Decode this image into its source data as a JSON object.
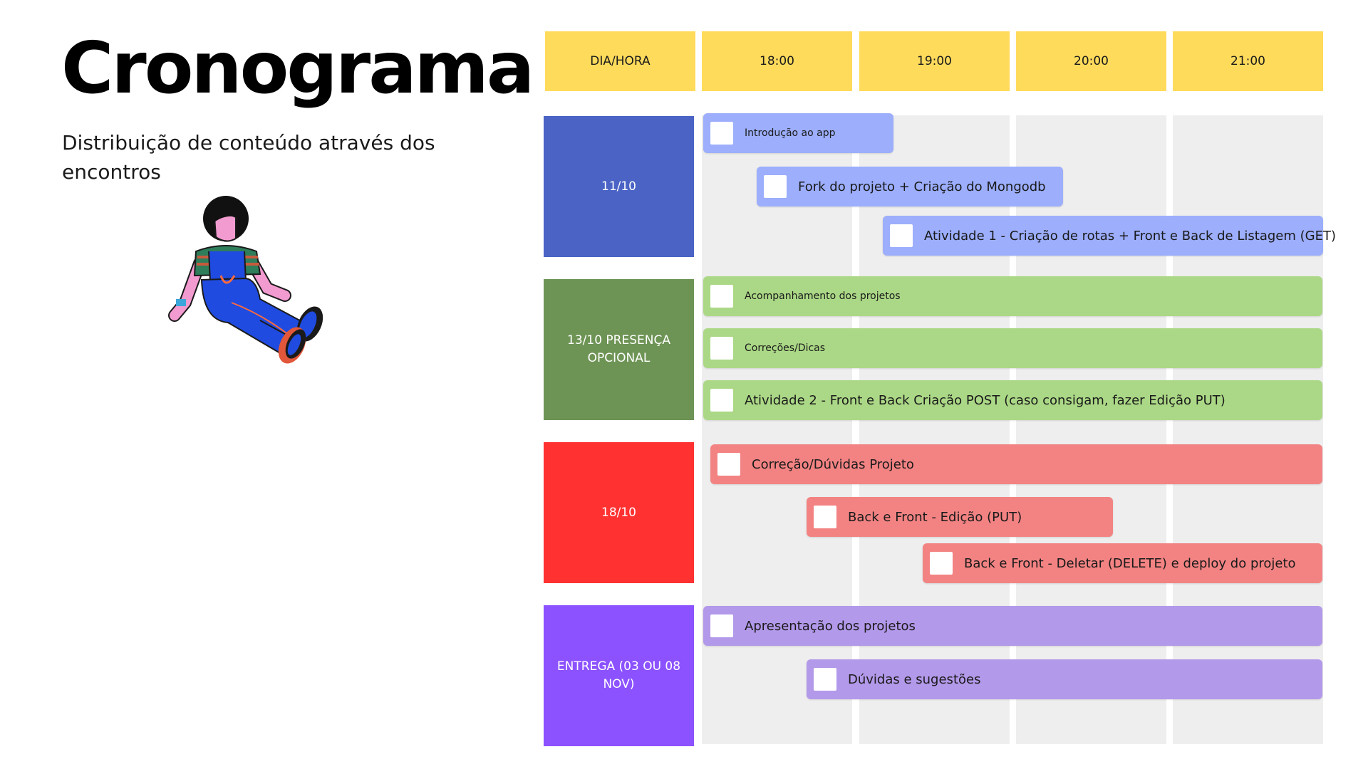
{
  "page": {
    "title": "Cronograma",
    "subtitle": "Distribuição de conteúdo através dos encontros"
  },
  "colors": {
    "header": "#FFDB5C",
    "column_bg": "#EEEEEE",
    "day1": "#4A63C5",
    "day1_bar": "#9CAEFC",
    "day2": "#6E9455",
    "day2_bar": "#ABD886",
    "day3": "#FF3131",
    "day3_bar": "#F38383",
    "day4": "#8C52FF",
    "day4_bar": "#B399EA"
  },
  "header": {
    "corner": "DIA/HORA",
    "times": [
      "18:00",
      "19:00",
      "20:00",
      "21:00"
    ]
  },
  "days": [
    {
      "label": "11/10",
      "tasks": [
        {
          "text": "Introdução ao app"
        },
        {
          "text": "Fork do projeto + Criação do Mongodb"
        },
        {
          "text": "Atividade 1 - Criação de rotas + Front e Back de Listagem (GET)"
        }
      ]
    },
    {
      "label": "13/10 PRESENÇA OPCIONAL",
      "tasks": [
        {
          "text": "Acompanhamento dos projetos"
        },
        {
          "text": "Correções/Dicas"
        },
        {
          "text": "Atividade 2 - Front e Back Criação POST (caso consigam, fazer Edição PUT)"
        }
      ]
    },
    {
      "label": "18/10",
      "tasks": [
        {
          "text": "Correção/Dúvidas Projeto"
        },
        {
          "text": "Back e Front - Edição (PUT)"
        },
        {
          "text": "Back e Front - Deletar (DELETE) e deploy do projeto"
        }
      ]
    },
    {
      "label": "ENTREGA (03 OU 08 NOV)",
      "tasks": [
        {
          "text": "Apresentação dos projetos"
        },
        {
          "text": "Dúvidas e sugestões"
        }
      ]
    }
  ],
  "illustration": {
    "icon": "sitting-person-illustration"
  }
}
